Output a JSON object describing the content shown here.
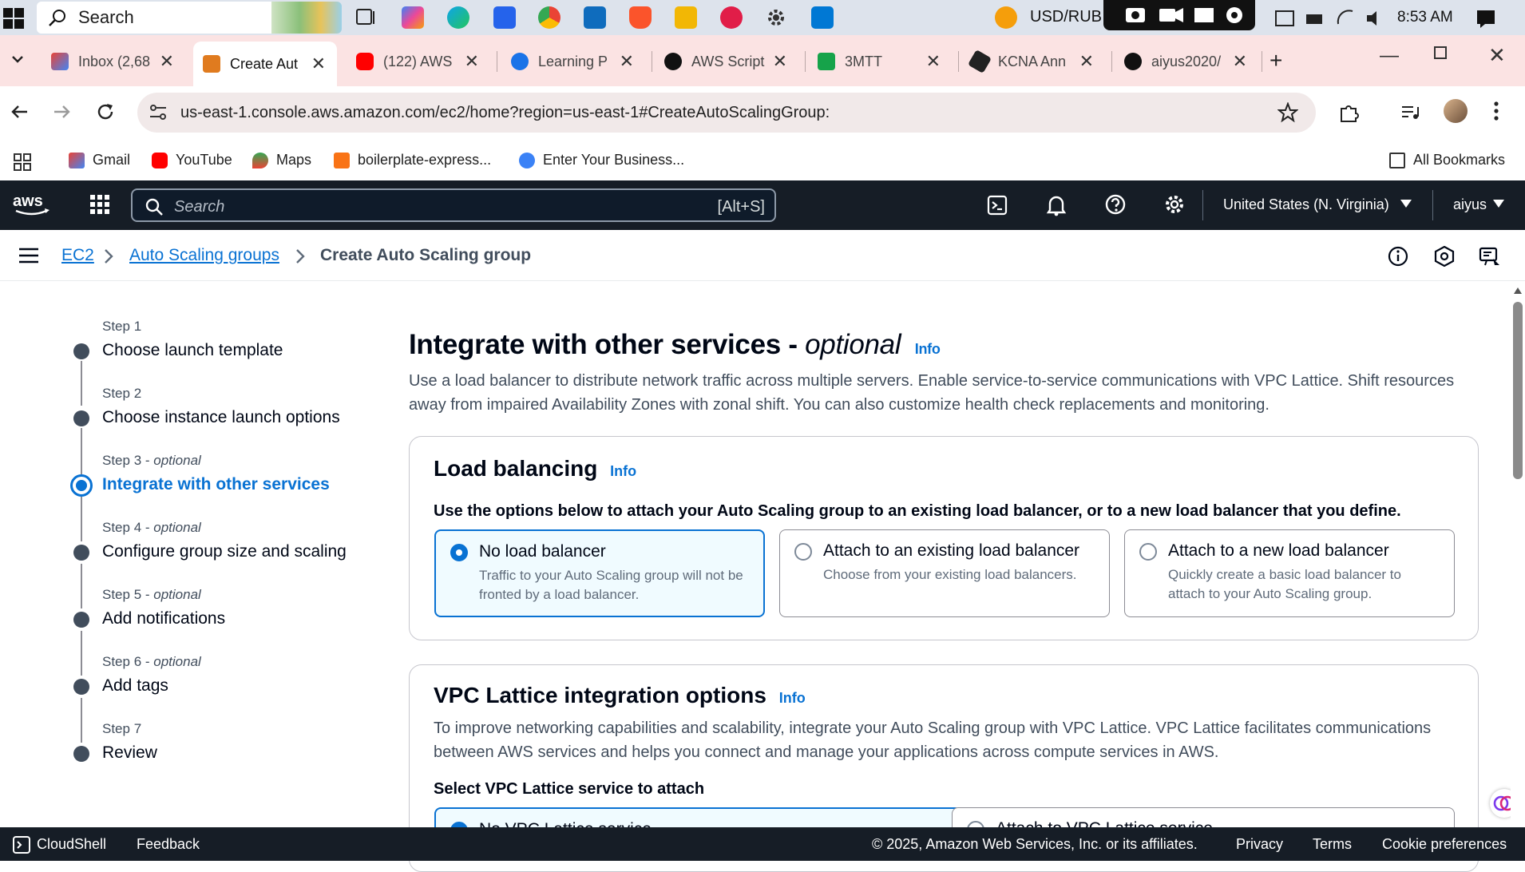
{
  "taskbar": {
    "search_placeholder": "Search",
    "currency": "USD/RUB",
    "clock": "8:53 AM"
  },
  "tabs": [
    {
      "title": "Inbox (2,68",
      "icon": "gmail-icon"
    },
    {
      "title": "Create Aut",
      "icon": "aws-ec2-icon"
    },
    {
      "title": "(122) AWS",
      "icon": "youtube-icon"
    },
    {
      "title": "Learning P",
      "icon": "learning-icon"
    },
    {
      "title": "AWS Script",
      "icon": "openai-icon"
    },
    {
      "title": "3MTT",
      "icon": "3mtt-icon"
    },
    {
      "title": "KCNA Ann",
      "icon": "kcna-icon"
    },
    {
      "title": "aiyus2020/",
      "icon": "github-icon"
    }
  ],
  "address_bar": {
    "url": "us-east-1.console.aws.amazon.com/ec2/home?region=us-east-1#CreateAutoScalingGroup:"
  },
  "bookmarks": {
    "items": [
      "Gmail",
      "YouTube",
      "Maps",
      "boilerplate-express...",
      "Enter Your Business..."
    ],
    "all": "All Bookmarks"
  },
  "aws_header": {
    "search_placeholder": "Search",
    "shortcut": "[Alt+S]",
    "region": "United States (N. Virginia)",
    "user": "aiyus"
  },
  "breadcrumb": {
    "items": [
      "EC2",
      "Auto Scaling groups"
    ],
    "current": "Create Auto Scaling group"
  },
  "steps": [
    {
      "label": "Step 1",
      "optional": "",
      "name": "Choose launch template"
    },
    {
      "label": "Step 2",
      "optional": "",
      "name": "Choose instance launch options"
    },
    {
      "label": "Step 3",
      "optional": "optional",
      "name": "Integrate with other services"
    },
    {
      "label": "Step 4",
      "optional": "optional",
      "name": "Configure group size and scaling"
    },
    {
      "label": "Step 5",
      "optional": "optional",
      "name": "Add notifications"
    },
    {
      "label": "Step 6",
      "optional": "optional",
      "name": "Add tags"
    },
    {
      "label": "Step 7",
      "optional": "",
      "name": "Review"
    }
  ],
  "page": {
    "title": "Integrate with other services - ",
    "title_optional": "optional",
    "info": "Info",
    "description": "Use a load balancer to distribute network traffic across multiple servers. Enable service-to-service communications with VPC Lattice. Shift resources away from impaired Availability Zones with zonal shift. You can also customize health check replacements and monitoring."
  },
  "load_balancing": {
    "title": "Load balancing",
    "info": "Info",
    "instruction": "Use the options below to attach your Auto Scaling group to an existing load balancer, or to a new load balancer that you define.",
    "options": [
      {
        "title": "No load balancer",
        "desc": "Traffic to your Auto Scaling group will not be fronted by a load balancer.",
        "selected": true
      },
      {
        "title": "Attach to an existing load balancer",
        "desc": "Choose from your existing load balancers.",
        "selected": false
      },
      {
        "title": "Attach to a new load balancer",
        "desc": "Quickly create a basic load balancer to attach to your Auto Scaling group.",
        "selected": false
      }
    ]
  },
  "vpc_lattice": {
    "title": "VPC Lattice integration options",
    "info": "Info",
    "description": "To improve networking capabilities and scalability, integrate your Auto Scaling group with VPC Lattice. VPC Lattice facilitates communications between AWS services and helps you connect and manage your applications across compute services in AWS.",
    "select_label": "Select VPC Lattice service to attach",
    "options": [
      "No VPC Lattice service",
      "Attach to VPC Lattice service"
    ]
  },
  "footer": {
    "cloudshell": "CloudShell",
    "feedback": "Feedback",
    "copyright": "© 2025, Amazon Web Services, Inc. or its affiliates.",
    "privacy": "Privacy",
    "terms": "Terms",
    "cookies": "Cookie preferences"
  },
  "colors": {
    "aws_header": "#161d26",
    "link": "#0972d3",
    "tab_strip": "#fbe3e3"
  }
}
